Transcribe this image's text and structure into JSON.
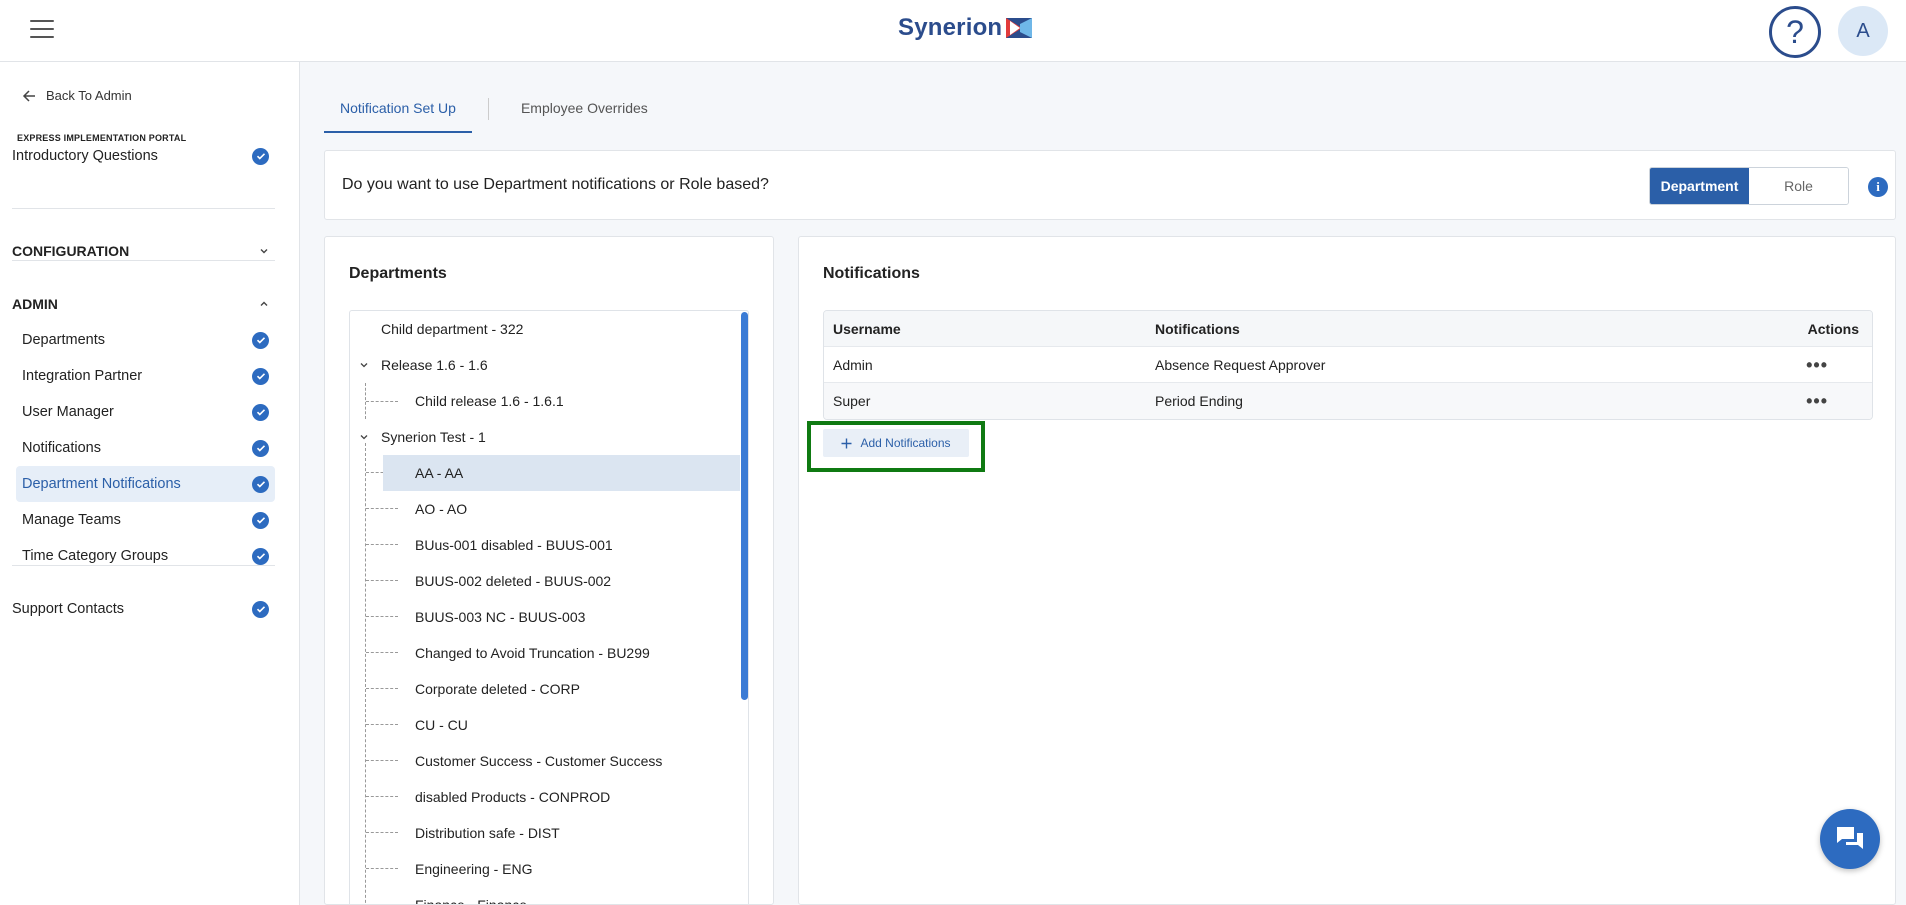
{
  "header": {
    "brand": "Synerion",
    "help_label": "?",
    "avatar_initial": "A"
  },
  "sidebar": {
    "back_label": "Back To Admin",
    "portal_title": "EXPRESS IMPLEMENTATION PORTAL",
    "intro_label": "Introductory Questions",
    "configuration_label": "CONFIGURATION",
    "admin_label": "ADMIN",
    "admin_items": [
      {
        "label": "Departments"
      },
      {
        "label": "Integration Partner"
      },
      {
        "label": "User Manager"
      },
      {
        "label": "Notifications"
      },
      {
        "label": "Department Notifications"
      },
      {
        "label": "Manage Teams"
      },
      {
        "label": "Time Category Groups"
      }
    ],
    "support_label": "Support Contacts"
  },
  "tabs": [
    {
      "label": "Notification Set Up"
    },
    {
      "label": "Employee Overrides"
    }
  ],
  "question": {
    "text": "Do you want to use Department notifications or Role based?",
    "options": [
      "Department",
      "Role"
    ],
    "selected": "Department",
    "info_label": "i"
  },
  "departments": {
    "title": "Departments",
    "tree": [
      {
        "label": "Child department - 322"
      },
      {
        "label": "Release 1.6 - 1.6"
      },
      {
        "label": "Child release 1.6 - 1.6.1"
      },
      {
        "label": "Synerion Test - 1"
      },
      {
        "label": "AA - AA"
      },
      {
        "label": "AO - AO"
      },
      {
        "label": "BUus-001 disabled - BUUS-001"
      },
      {
        "label": "BUUS-002 deleted - BUUS-002"
      },
      {
        "label": "BUUS-003 NC - BUUS-003"
      },
      {
        "label": "Changed to Avoid Truncation - BU299"
      },
      {
        "label": "Corporate deleted - CORP"
      },
      {
        "label": "CU - CU"
      },
      {
        "label": "Customer Success - Customer Success"
      },
      {
        "label": "disabled Products - CONPROD"
      },
      {
        "label": "Distribution safe - DIST"
      },
      {
        "label": "Engineering - ENG"
      },
      {
        "label": "Finance - Finance"
      }
    ]
  },
  "notifications": {
    "title": "Notifications",
    "columns": [
      "Username",
      "Notifications",
      "Actions"
    ],
    "rows": [
      {
        "username": "Admin",
        "notification": "Absence Request Approver",
        "actions": "•••"
      },
      {
        "username": "Super",
        "notification": "Period Ending",
        "actions": "•••"
      }
    ],
    "add_label": "Add Notifications"
  },
  "colors": {
    "brand": "#2b4c8c",
    "accent": "#2b5fa8",
    "highlight": "#0f7a12"
  }
}
